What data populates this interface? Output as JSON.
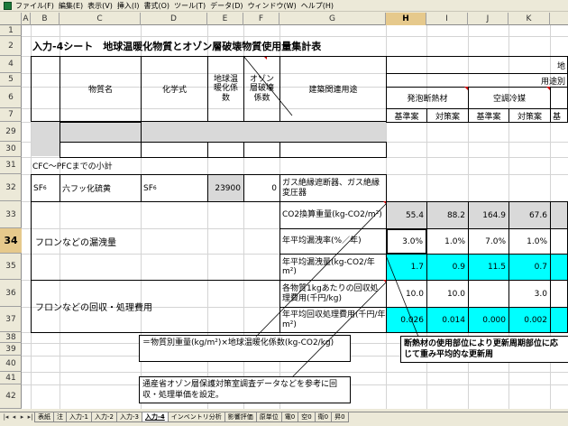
{
  "menu": [
    "ファイル(F)",
    "編集(E)",
    "表示(V)",
    "挿入(I)",
    "書式(O)",
    "ツール(T)",
    "データ(D)",
    "ウィンドウ(W)",
    "ヘルプ(H)"
  ],
  "columns": [
    "A",
    "B",
    "C",
    "D",
    "E",
    "F",
    "G",
    "H",
    "I",
    "J",
    "K"
  ],
  "selected_column": "H",
  "rows": [
    "1",
    "2",
    "4",
    "5",
    "6",
    "7",
    "29",
    "30",
    "31",
    "32",
    "33",
    "34",
    "35",
    "36",
    "37",
    "38",
    "39",
    "40",
    "41",
    "42"
  ],
  "selected_row": "34",
  "sheet_title": "入力-4シート　地球温暖化物質とオゾン層破壊物質使用量集計表",
  "header": {
    "substance": "物質名",
    "formula": "化学式",
    "gwp": "地球温暖化係数",
    "odp": "オゾン層破壊係数",
    "usage": "建築関連用途",
    "top_right": "地",
    "use_label": "用途別",
    "foam": "発泡断熱材",
    "ac": "空調冷媒",
    "base1": "基準案",
    "plan1": "対策案",
    "base2": "基準案",
    "plan2": "対策案",
    "base3": "基"
  },
  "subtotal_label": "CFC～PFCまでの小計",
  "sf6": {
    "symbol": "SF",
    "symbol_sub": "6",
    "name": "六フッ化硫黄",
    "formula": "SF",
    "formula_sub": "6",
    "gwp": "23900",
    "odp": "0",
    "usage": "ガス絶縁遮断器、ガス絶縁変圧器"
  },
  "leak_label": "フロンなどの漏洩量",
  "recovery_label": "フロンなどの回収・処理費用",
  "metrics": [
    {
      "label": "CO2換算重量(kg-CO2/m²)",
      "values": [
        "55.4",
        "88.2",
        "164.9",
        "67.6"
      ]
    },
    {
      "label": "年平均漏洩率(%／年)",
      "values": [
        "3.0%",
        "1.0%",
        "7.0%",
        "1.0%"
      ]
    },
    {
      "label": "年平均漏洩量(kg-CO2/年m²)",
      "values": [
        "1.7",
        "0.9",
        "11.5",
        "0.7"
      ]
    },
    {
      "label": "各物質1kgあたりの回収処理費用(千円/kg)",
      "values": [
        "10.0",
        "10.0",
        "",
        "3.0"
      ]
    },
    {
      "label": "年平均回収処理費用(千円/年m²)",
      "values": [
        "0.026",
        "0.014",
        "0.000",
        "0.002"
      ]
    }
  ],
  "callouts": {
    "formula_note": "＝物質別重量(kg/m²)×地球温暖化係数(kg-CO2/kg)",
    "cost_note": "通産省オゾン層保護対策室調査データなどを参考に回収・処理単価を設定。",
    "renewal_note": "断熱材の使用部位により更新周期部位に応じて重み平均的な更新周"
  },
  "sheet_tabs": [
    "表紙",
    "注",
    "入力-1",
    "入力-2",
    "入力-3",
    "入力-4",
    "インベントリ分析",
    "影響評価",
    "原単位",
    "電0",
    "空0",
    "衛0",
    "昇0"
  ],
  "active_tab": "入力-4",
  "colors": {
    "cyan": "#00ffff",
    "gray": "#d9d9d9",
    "header_sel": "#e6c98c"
  }
}
